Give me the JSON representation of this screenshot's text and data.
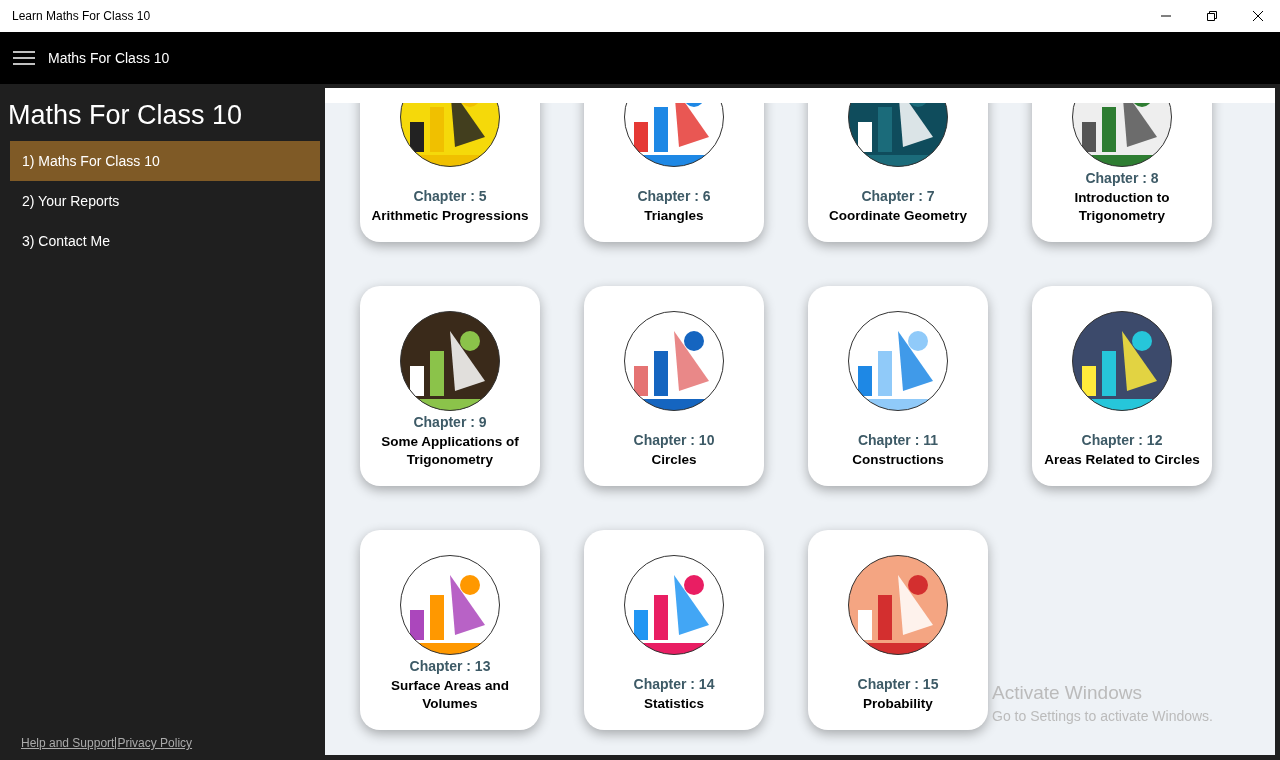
{
  "window": {
    "title": "Learn Maths For Class 10"
  },
  "header": {
    "title": "Maths For Class 10"
  },
  "sidebar": {
    "title": "Maths For Class 10",
    "items": [
      {
        "label": "1) Maths For Class 10",
        "selected": true
      },
      {
        "label": "2) Your Reports",
        "selected": false
      },
      {
        "label": "3) Contact Me",
        "selected": false
      }
    ],
    "links": [
      "Help and Support",
      "Privacy Policy"
    ]
  },
  "chapters": [
    {
      "chapter": "Chapter :  5",
      "title": "Arithmetic Progressions"
    },
    {
      "chapter": "Chapter :  6",
      "title": "Triangles"
    },
    {
      "chapter": "Chapter :  7",
      "title": "Coordinate Geometry"
    },
    {
      "chapter": "Chapter :  8",
      "title": "Introduction to Trigonometry"
    },
    {
      "chapter": "Chapter :  9",
      "title": "Some Applications of Trigonometry"
    },
    {
      "chapter": "Chapter :  10",
      "title": "Circles"
    },
    {
      "chapter": "Chapter :  11",
      "title": "Constructions"
    },
    {
      "chapter": "Chapter :  12",
      "title": "Areas Related to Circles"
    },
    {
      "chapter": "Chapter :  13",
      "title": "Surface Areas and Volumes"
    },
    {
      "chapter": "Chapter :  14",
      "title": "Statistics"
    },
    {
      "chapter": "Chapter :  15",
      "title": "Probability"
    }
  ],
  "activation_notice": {
    "title": "Activate Windows",
    "text": "Go to Settings to activate Windows."
  }
}
